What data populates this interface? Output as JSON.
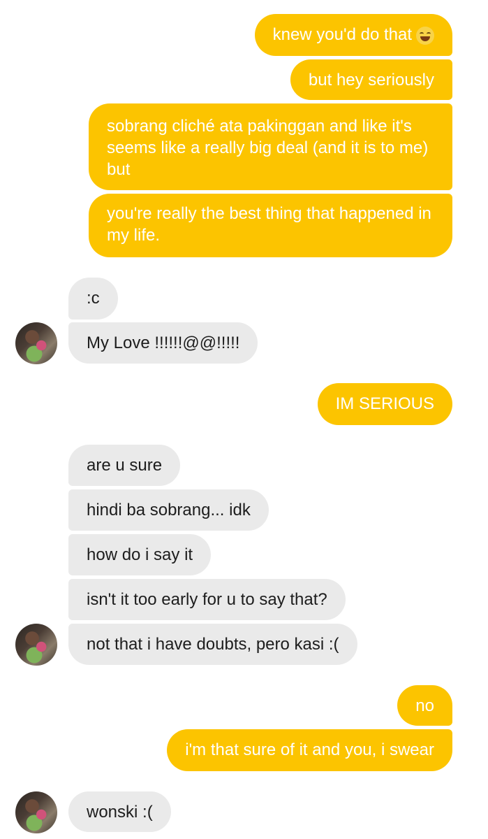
{
  "messages": [
    {
      "text": "knew you'd do that",
      "emoji": "joy-emoji-icon"
    },
    {
      "text": "but hey seriously"
    },
    {
      "text": "sobrang cliché ata pakinggan and like it's seems like a really big deal (and it is to me) but"
    },
    {
      "text": "you're really the best thing that happened in my life."
    },
    {
      "text": ":c"
    },
    {
      "text": "My Love !!!!!!@@!!!!!"
    },
    {
      "text": "IM SERIOUS"
    },
    {
      "text": "are u sure"
    },
    {
      "text": "hindi ba sobrang... idk"
    },
    {
      "text": "how do i say it"
    },
    {
      "text": "isn't it too early for u to say that?"
    },
    {
      "text": "not that i have doubts, pero kasi :("
    },
    {
      "text": "no"
    },
    {
      "text": "i'm that sure of it and you, i swear"
    },
    {
      "text": "wonski :("
    }
  ],
  "colors": {
    "sent_bubble": "#FCC400",
    "received_bubble": "#EAEAEA"
  }
}
